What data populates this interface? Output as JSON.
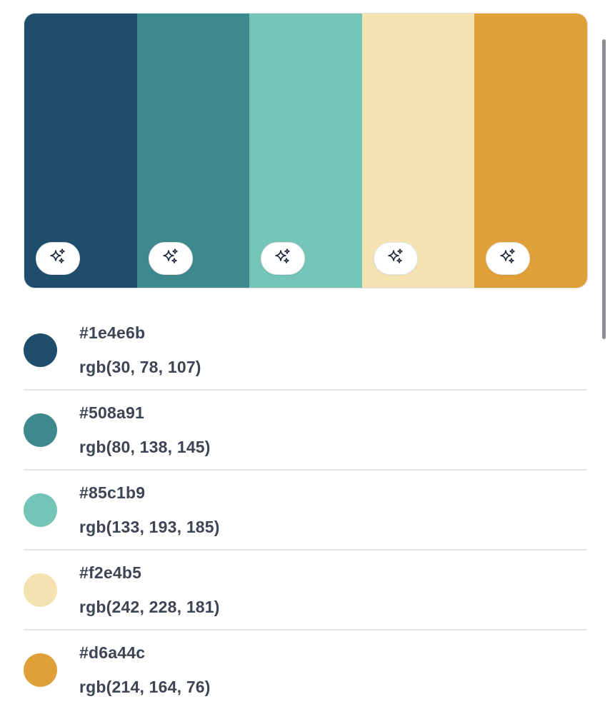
{
  "palette": {
    "swatches": [
      {
        "color": "#1e4e6b",
        "button_icon": "sparkles-icon"
      },
      {
        "color": "#3e898e",
        "button_icon": "sparkles-icon"
      },
      {
        "color": "#74c4b8",
        "button_icon": "sparkles-icon"
      },
      {
        "color": "#f4e2b0",
        "button_icon": "sparkles-icon"
      },
      {
        "color": "#e0a038",
        "button_icon": "sparkles-icon"
      }
    ]
  },
  "colors": [
    {
      "hex": "#1e4e6b",
      "rgb": "rgb(30, 78, 107)",
      "swatch_color": "#1e4e6b"
    },
    {
      "hex": "#508a91",
      "rgb": "rgb(80, 138, 145)",
      "swatch_color": "#3e898e"
    },
    {
      "hex": "#85c1b9",
      "rgb": "rgb(133, 193, 185)",
      "swatch_color": "#74c4b8"
    },
    {
      "hex": "#f2e4b5",
      "rgb": "rgb(242, 228, 181)",
      "swatch_color": "#f4e2b0"
    },
    {
      "hex": "#d6a44c",
      "rgb": "rgb(214, 164, 76)",
      "swatch_color": "#e0a038"
    }
  ]
}
